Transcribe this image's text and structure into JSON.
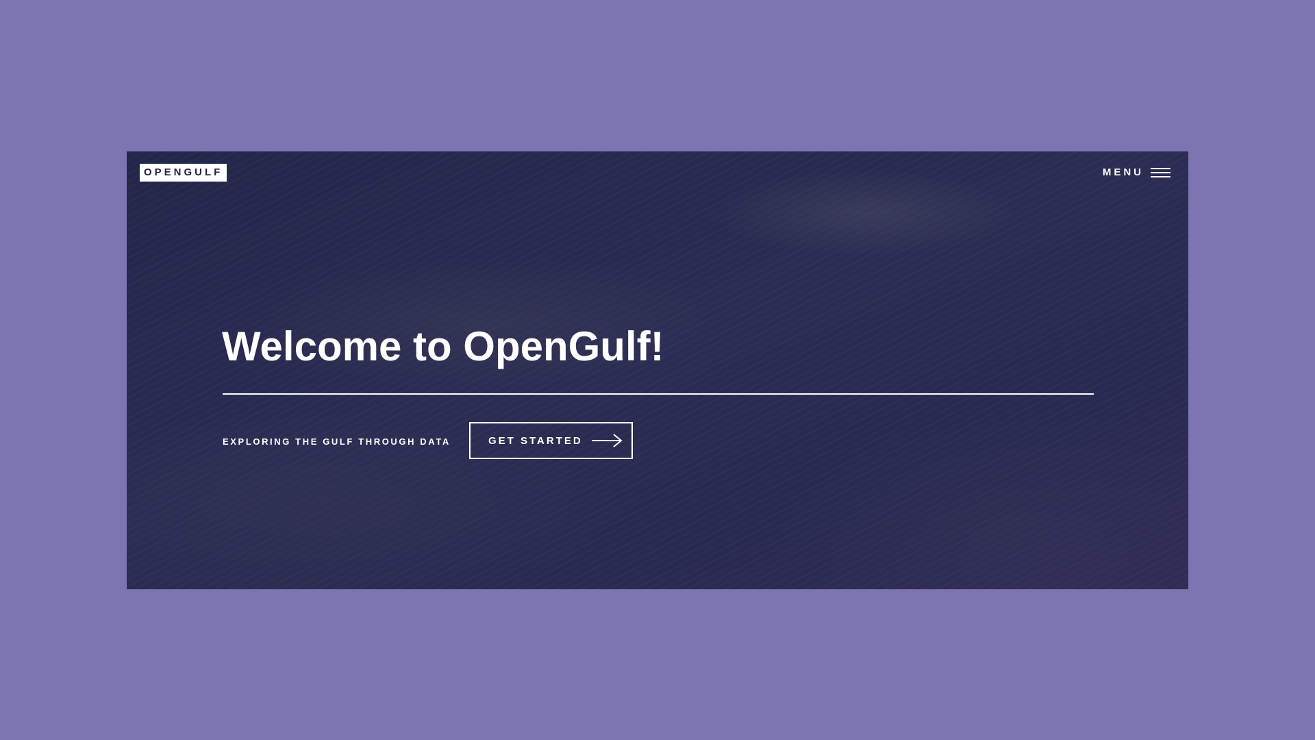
{
  "header": {
    "logo_text": "OPENGULF",
    "menu_label": "MENU",
    "menu_icon": "hamburger-icon"
  },
  "hero": {
    "title": "Welcome to OpenGulf!",
    "tagline": "EXPLORING THE GULF THROUGH DATA",
    "cta_label": "GET STARTED",
    "cta_icon": "arrow-right-icon"
  },
  "colors": {
    "page_background": "#7d75b2",
    "hero_overlay": "#232748",
    "text": "#ffffff"
  }
}
